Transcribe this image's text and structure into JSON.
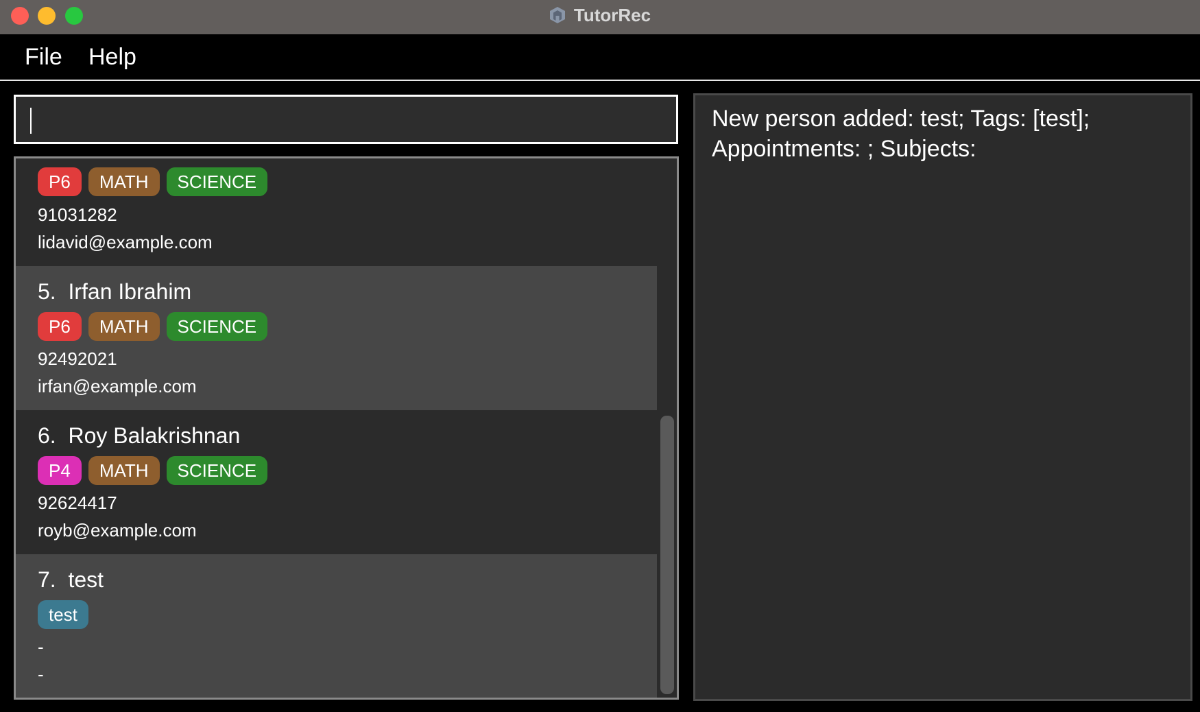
{
  "window": {
    "title": "TutorRec"
  },
  "menu": {
    "file": "File",
    "help": "Help"
  },
  "command": {
    "value": ""
  },
  "persons": [
    {
      "name": "",
      "tags": [
        {
          "label": "P6",
          "color": "#e13c3c"
        },
        {
          "label": "MATH",
          "color": "#8e5e2e"
        },
        {
          "label": "SCIENCE",
          "color": "#2d8a2d"
        }
      ],
      "phone": "91031282",
      "email": "lidavid@example.com"
    },
    {
      "name": "5.  Irfan Ibrahim",
      "tags": [
        {
          "label": "P6",
          "color": "#e13c3c"
        },
        {
          "label": "MATH",
          "color": "#8e5e2e"
        },
        {
          "label": "SCIENCE",
          "color": "#2d8a2d"
        }
      ],
      "phone": "92492021",
      "email": "irfan@example.com"
    },
    {
      "name": "6.  Roy Balakrishnan",
      "tags": [
        {
          "label": "P4",
          "color": "#dc2fb5"
        },
        {
          "label": "MATH",
          "color": "#8e5e2e"
        },
        {
          "label": "SCIENCE",
          "color": "#2d8a2d"
        }
      ],
      "phone": "92624417",
      "email": "royb@example.com"
    },
    {
      "name": "7.  test",
      "tags": [
        {
          "label": "test",
          "color": "#3c7a90"
        }
      ],
      "phone": "-",
      "email": "-"
    }
  ],
  "result": {
    "message": "New person added: test; Tags: [test]; Appointments: ; Subjects:"
  }
}
